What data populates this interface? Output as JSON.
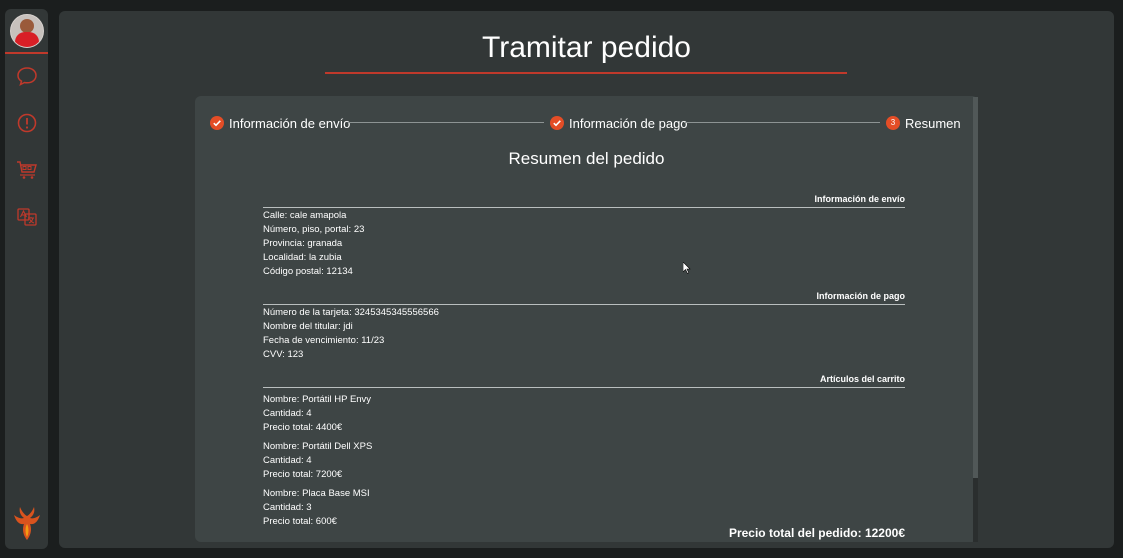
{
  "page": {
    "title": "Tramitar pedido"
  },
  "colors": {
    "accent": "#c0392b",
    "step_icon": "#e44d26",
    "panel": "#323737",
    "card": "#3e4545",
    "background": "#1b1e1e"
  },
  "sidebar": {
    "icons": [
      "avatar",
      "chat-bubble-icon",
      "alert-icon",
      "cart-icon",
      "translate-icon",
      "phoenix-logo-icon"
    ]
  },
  "stepper": {
    "steps": [
      {
        "label": "Información de envío",
        "state": "done"
      },
      {
        "label": "Información de pago",
        "state": "done"
      },
      {
        "number": "3",
        "label": "Resumen",
        "state": "active"
      }
    ]
  },
  "summary": {
    "title": "Resumen del pedido",
    "shipping": {
      "heading": "Información de envío",
      "lines": [
        "Calle: cale amapola",
        "Número, piso, portal: 23",
        "Provincia: granada",
        "Localidad: la zubia",
        "Código postal: 12134"
      ]
    },
    "payment": {
      "heading": "Información de pago",
      "lines": [
        "Número de la tarjeta: 3245345345556566",
        "Nombre del titular: jdi",
        "Fecha de vencimiento: 11/23",
        "CVV: 123"
      ]
    },
    "cart": {
      "heading": "Artículos del carrito",
      "items": [
        {
          "name": "Nombre: Portátil HP Envy",
          "qty": "Cantidad: 4",
          "total": "Precio total: 4400€"
        },
        {
          "name": "Nombre: Portátil Dell XPS",
          "qty": "Cantidad: 4",
          "total": "Precio total: 7200€"
        },
        {
          "name": "Nombre: Placa Base MSI",
          "qty": "Cantidad: 3",
          "total": "Precio total: 600€"
        }
      ]
    },
    "order_total": "Precio total del pedido: 12200€"
  }
}
